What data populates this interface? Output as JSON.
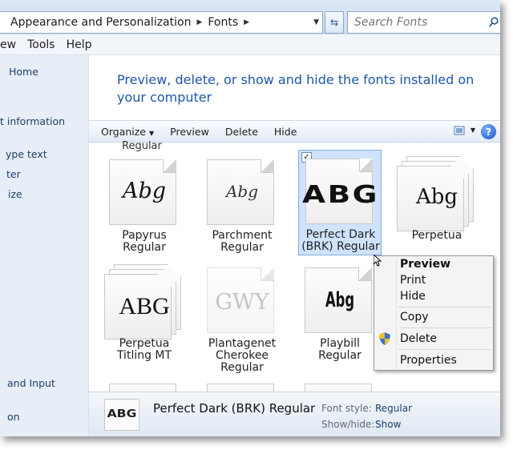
{
  "address": {
    "crumbs": [
      "Appearance and Personalization",
      "Fonts"
    ],
    "search_placeholder": "Search Fonts"
  },
  "menubar": {
    "items": [
      "ew",
      "Tools",
      "Help"
    ]
  },
  "nav": {
    "links": [
      "Home",
      "t information",
      "ype text",
      "ter",
      "ize",
      "and Input",
      "on"
    ]
  },
  "heading": "Preview, delete, or show and hide the fonts installed on your computer",
  "commandbar": {
    "organize": "Organize",
    "preview": "Preview",
    "delete": "Delete",
    "hide": "Hide",
    "help": "?"
  },
  "cut_label": "Regular",
  "fonts": [
    {
      "name": "Papyrus Regular",
      "line1": "Papyrus",
      "line2": "Regular",
      "sample": "Abg"
    },
    {
      "name": "Parchment Regular",
      "line1": "Parchment",
      "line2": "Regular",
      "sample": "Abg"
    },
    {
      "name": "Perfect Dark (BRK) Regular",
      "line1": "Perfect Dark",
      "line2": "(BRK) Regular",
      "sample": "ABG",
      "selected": true
    },
    {
      "name": "Perpetua",
      "line1": "Perpetua",
      "line2": "",
      "sample": "Abg"
    },
    {
      "name": "Perpetua Titling MT",
      "line1": "Perpetua",
      "line2": "Titling MT",
      "sample": "ABG"
    },
    {
      "name": "Plantagenet Cherokee Regular",
      "line1": "Plantagenet",
      "line2": "Cherokee",
      "line3": "Regular",
      "sample": "GWY"
    },
    {
      "name": "Playbill Regular",
      "line1": "Playbill",
      "line2": "Regular",
      "sample": "Abg"
    }
  ],
  "context_menu": {
    "preview": "Preview",
    "print": "Print",
    "hide": "Hide",
    "copy": "Copy",
    "delete": "Delete",
    "properties": "Properties"
  },
  "details": {
    "font_name": "Perfect Dark (BRK) Regular",
    "thumb_sample": "ABG",
    "style_label": "Font style:",
    "style_value": "Regular",
    "showhide_label": "Show/hide:",
    "showhide_value": "Show"
  },
  "colors": {
    "link": "#1e57a8",
    "selection": "#cfe3fc",
    "nav_bg": "#e7eef7"
  }
}
